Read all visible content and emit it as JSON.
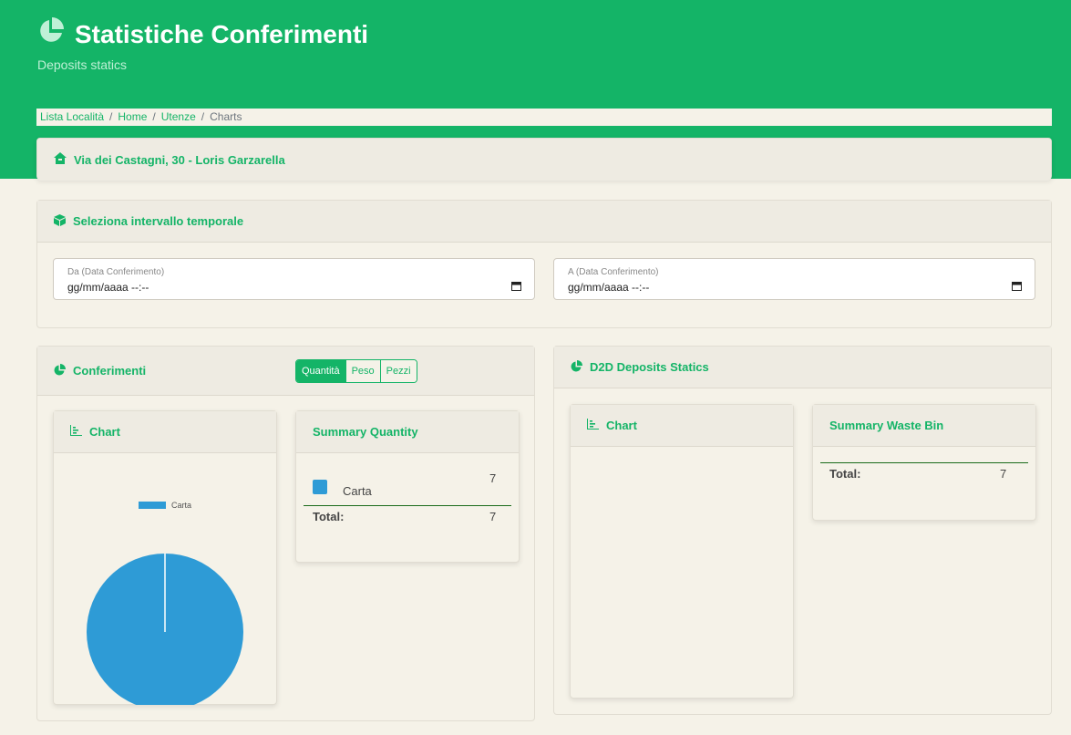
{
  "header": {
    "title": "Statistiche Conferimenti",
    "subtitle": "Deposits statics",
    "icon": "chart-pie-icon"
  },
  "breadcrumb": {
    "items": [
      "Lista Località",
      "Home",
      "Utenze",
      "Charts"
    ],
    "separator": "/"
  },
  "address": {
    "text": "Via dei Castagni, 30 - Loris Garzarella",
    "icon": "home-icon"
  },
  "range": {
    "title": "Seleziona intervallo temporale",
    "icon": "cube-icon",
    "from": {
      "label": "Da (Data Conferimento)",
      "value": "gg/mm/aaaa --:--"
    },
    "to": {
      "label": "A (Data Conferimento)",
      "value": "gg/mm/aaaa --:--"
    }
  },
  "conferimenti": {
    "title": "Conferimenti",
    "toggle": [
      "Quantità",
      "Peso",
      "Pezzi"
    ],
    "selected_toggle": "Quantità",
    "chart_title": "Chart",
    "summary_title": "Summary Quantity",
    "summary_rows": [
      {
        "label": "Carta",
        "value": "7",
        "color": "#2e9bd6"
      }
    ],
    "total_label": "Total:",
    "total_value": "7"
  },
  "d2d": {
    "title": "D2D Deposits Statics",
    "chart_title": "Chart",
    "summary_title": "Summary Waste Bin",
    "total_label": "Total:",
    "total_value": "7"
  },
  "chart_data": {
    "type": "pie",
    "labels": [
      "Carta"
    ],
    "values": [
      7
    ],
    "colors": [
      "#2e9bd6"
    ],
    "legend": "top"
  },
  "colors": {
    "brand": "#14b467",
    "background": "#f5f2e8",
    "pie_blue": "#2e9bd6"
  }
}
